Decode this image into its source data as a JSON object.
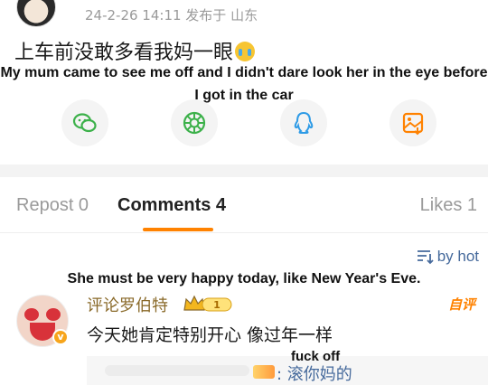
{
  "post": {
    "meta": "24-2-26 14:11  发布于 山东",
    "text": "上车前没敢多看我妈一眼",
    "emoji": "crying-face"
  },
  "overlays": {
    "caption_1": "My mum came to see me off and I didn't dare look her in the eye before I got in the car",
    "caption_2": "She must be very happy today, like New Year's Eve.",
    "caption_3": "fuck off"
  },
  "share": {
    "items": [
      {
        "icon": "wechat-icon",
        "color": "#3cb14a"
      },
      {
        "icon": "moments-icon",
        "color": "#3cb14a"
      },
      {
        "icon": "qq-icon",
        "color": "#2e9be6"
      },
      {
        "icon": "save-image-icon",
        "color": "#ff8200"
      }
    ]
  },
  "tabs": {
    "repost": "Repost 0",
    "comments": "Comments 4",
    "likes": "Likes 1",
    "accent": "#ff8200"
  },
  "sort": {
    "label": "by hot"
  },
  "comment": {
    "author": "评论罗伯特",
    "level": "1",
    "tag": "自评",
    "text": "今天她肯定特别开心 像过年一样",
    "reply": ": 滚你妈的"
  }
}
